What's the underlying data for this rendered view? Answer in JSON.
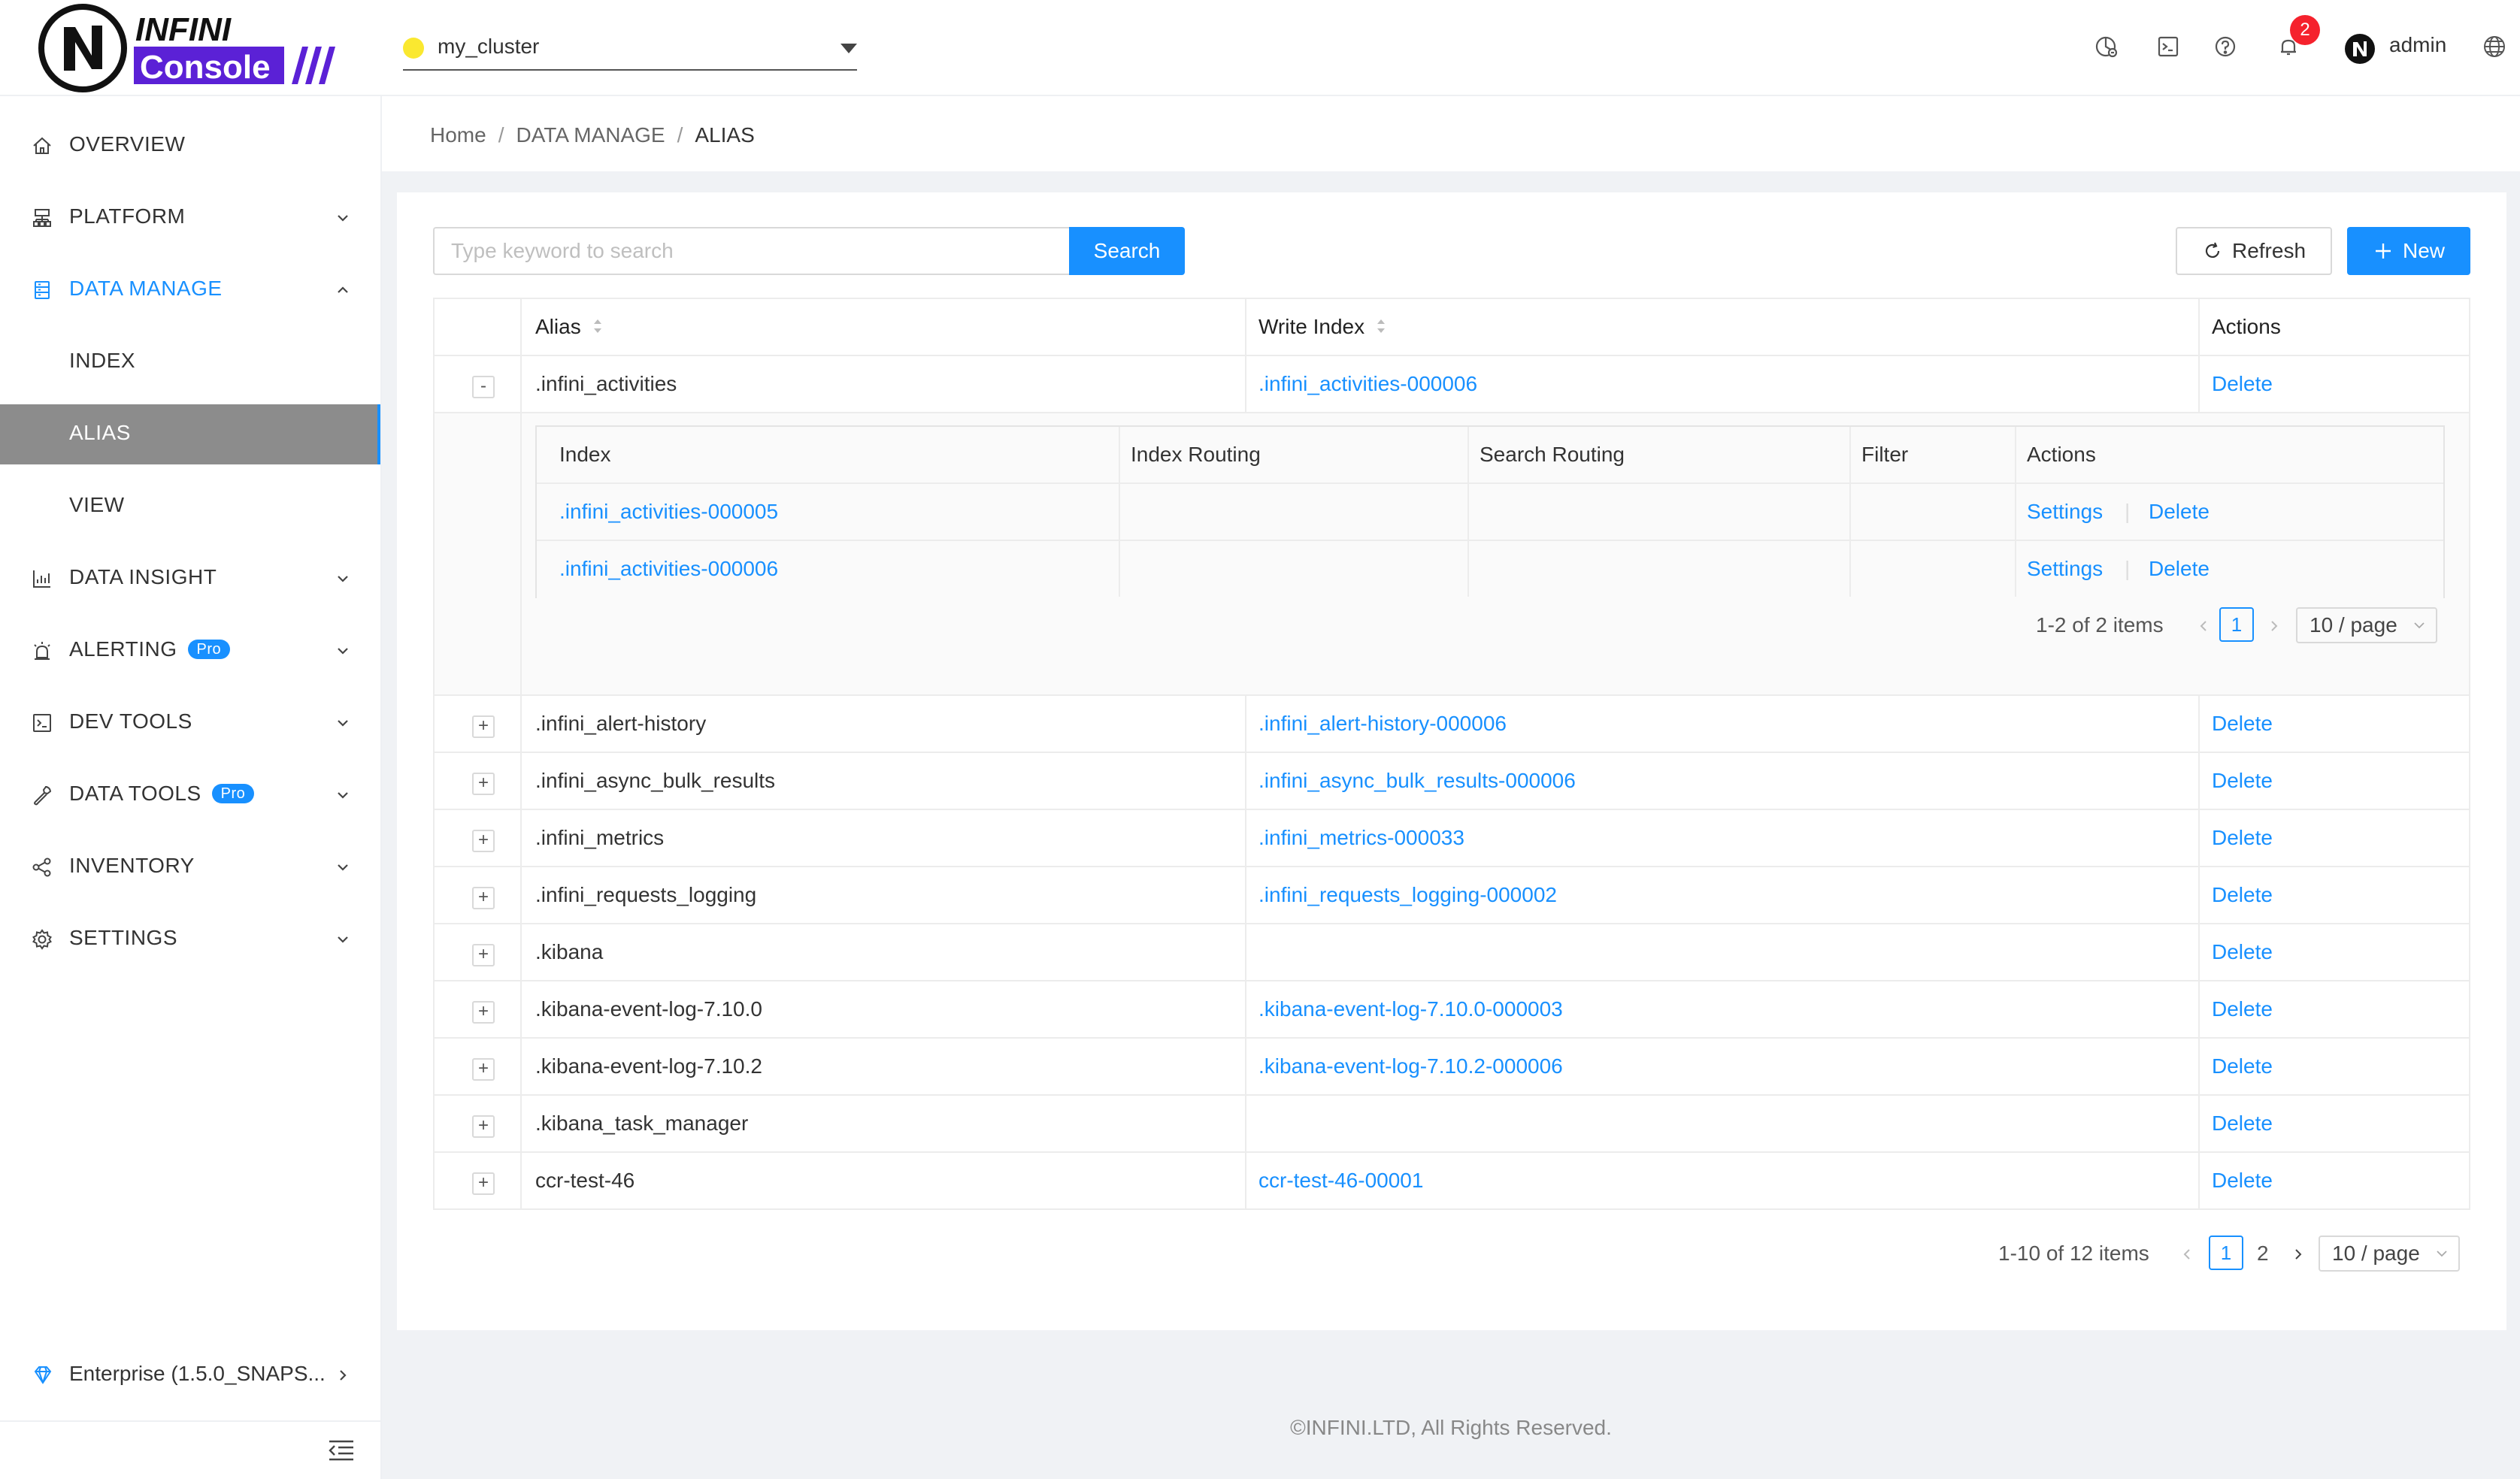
{
  "app": {
    "logo_top": "INFINI",
    "logo_bottom": "Console"
  },
  "header": {
    "cluster": {
      "name": "my_cluster",
      "status_color": "#fae830"
    },
    "icons": [
      "dashboard-icon",
      "terminal-icon",
      "help-icon",
      "bell-icon",
      "language-icon"
    ],
    "notification_count": "2",
    "user": "admin"
  },
  "sidebar": {
    "items": [
      {
        "label": "OVERVIEW",
        "icon": "home-icon"
      },
      {
        "label": "PLATFORM",
        "icon": "cluster-icon"
      },
      {
        "label": "DATA MANAGE",
        "icon": "database-icon"
      },
      {
        "label": "INDEX"
      },
      {
        "label": "ALIAS"
      },
      {
        "label": "VIEW"
      },
      {
        "label": "DATA INSIGHT",
        "icon": "chart-icon"
      },
      {
        "label": "ALERTING",
        "icon": "alarm-icon",
        "badge": "Pro"
      },
      {
        "label": "DEV TOOLS",
        "icon": "console-icon"
      },
      {
        "label": "DATA TOOLS",
        "icon": "wrench-icon",
        "badge": "Pro"
      },
      {
        "label": "INVENTORY",
        "icon": "share-icon"
      },
      {
        "label": "SETTINGS",
        "icon": "gear-icon"
      }
    ],
    "version": "Enterprise (1.5.0_SNAPS..."
  },
  "breadcrumb": {
    "home": "Home",
    "section": "DATA MANAGE",
    "current": "ALIAS"
  },
  "toolbar": {
    "search_placeholder": "Type keyword to search",
    "search_label": "Search",
    "refresh_label": "Refresh",
    "new_label": "New"
  },
  "table": {
    "columns": {
      "alias": "Alias",
      "write_index": "Write Index",
      "actions": "Actions"
    },
    "expanded": {
      "alias": ".infini_activities",
      "write_index": ".infini_activities-000006",
      "action": "Delete",
      "toggle": "-",
      "nested": {
        "columns": {
          "index": "Index",
          "index_routing": "Index Routing",
          "search_routing": "Search Routing",
          "filter": "Filter",
          "actions": "Actions"
        },
        "rows": [
          {
            "index": ".infini_activities-000005",
            "settings": "Settings",
            "delete": "Delete"
          },
          {
            "index": ".infini_activities-000006",
            "settings": "Settings",
            "delete": "Delete"
          }
        ],
        "pagination": {
          "summary": "1-2 of 2 items",
          "current": "1",
          "page_size": "10 / page"
        }
      }
    },
    "rows": [
      {
        "alias": ".infini_alert-history",
        "write_index": ".infini_alert-history-000006",
        "action": "Delete",
        "toggle": "+"
      },
      {
        "alias": ".infini_async_bulk_results",
        "write_index": ".infini_async_bulk_results-000006",
        "action": "Delete",
        "toggle": "+"
      },
      {
        "alias": ".infini_metrics",
        "write_index": ".infini_metrics-000033",
        "action": "Delete",
        "toggle": "+"
      },
      {
        "alias": ".infini_requests_logging",
        "write_index": ".infini_requests_logging-000002",
        "action": "Delete",
        "toggle": "+"
      },
      {
        "alias": ".kibana",
        "write_index": "",
        "action": "Delete",
        "toggle": "+"
      },
      {
        "alias": ".kibana-event-log-7.10.0",
        "write_index": ".kibana-event-log-7.10.0-000003",
        "action": "Delete",
        "toggle": "+"
      },
      {
        "alias": ".kibana-event-log-7.10.2",
        "write_index": ".kibana-event-log-7.10.2-000006",
        "action": "Delete",
        "toggle": "+"
      },
      {
        "alias": ".kibana_task_manager",
        "write_index": "",
        "action": "Delete",
        "toggle": "+"
      },
      {
        "alias": "ccr-test-46",
        "write_index": "ccr-test-46-00001",
        "action": "Delete",
        "toggle": "+"
      }
    ],
    "pagination": {
      "summary": "1-10 of 12 items",
      "current": "1",
      "next_page": "2",
      "page_size": "10 / page"
    }
  },
  "footer": "©INFINI.LTD, All Rights Reserved.",
  "colors": {
    "primary": "#1890ff",
    "selected_bg": "#8c8c8c",
    "badge": "#f5222d"
  }
}
